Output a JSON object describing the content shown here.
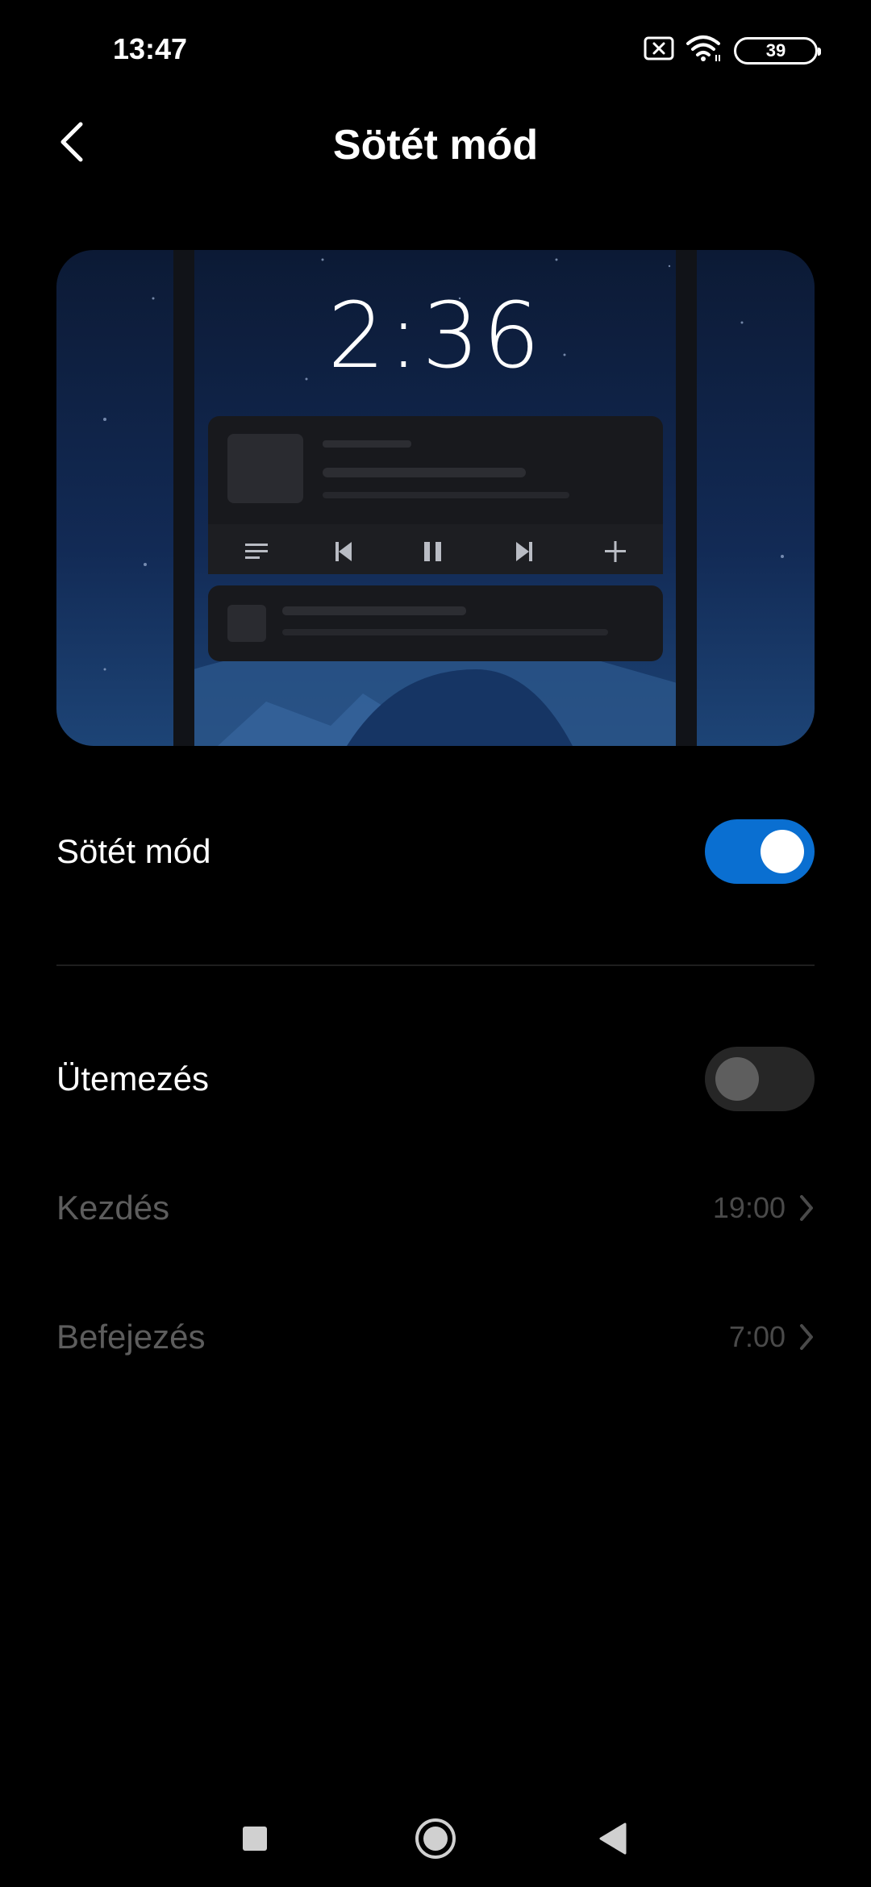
{
  "status_bar": {
    "time": "13:47",
    "battery_level": "39"
  },
  "header": {
    "title": "Sötét mód"
  },
  "preview": {
    "clock": "2:36"
  },
  "dark_mode_row": {
    "label": "Sötét mód",
    "enabled": true
  },
  "schedule_row": {
    "label": "Ütemezés",
    "enabled": false
  },
  "start_row": {
    "label": "Kezdés",
    "value": "19:00"
  },
  "end_row": {
    "label": "Befejezés",
    "value": "7:00"
  },
  "colors": {
    "accent": "#0a6fd1",
    "background": "#000000"
  },
  "icons": [
    "back-arrow-icon",
    "sim-x-icon",
    "wifi-icon",
    "battery-icon",
    "chevron-right-icon",
    "recents-square-icon",
    "home-circle-icon",
    "back-triangle-icon"
  ]
}
